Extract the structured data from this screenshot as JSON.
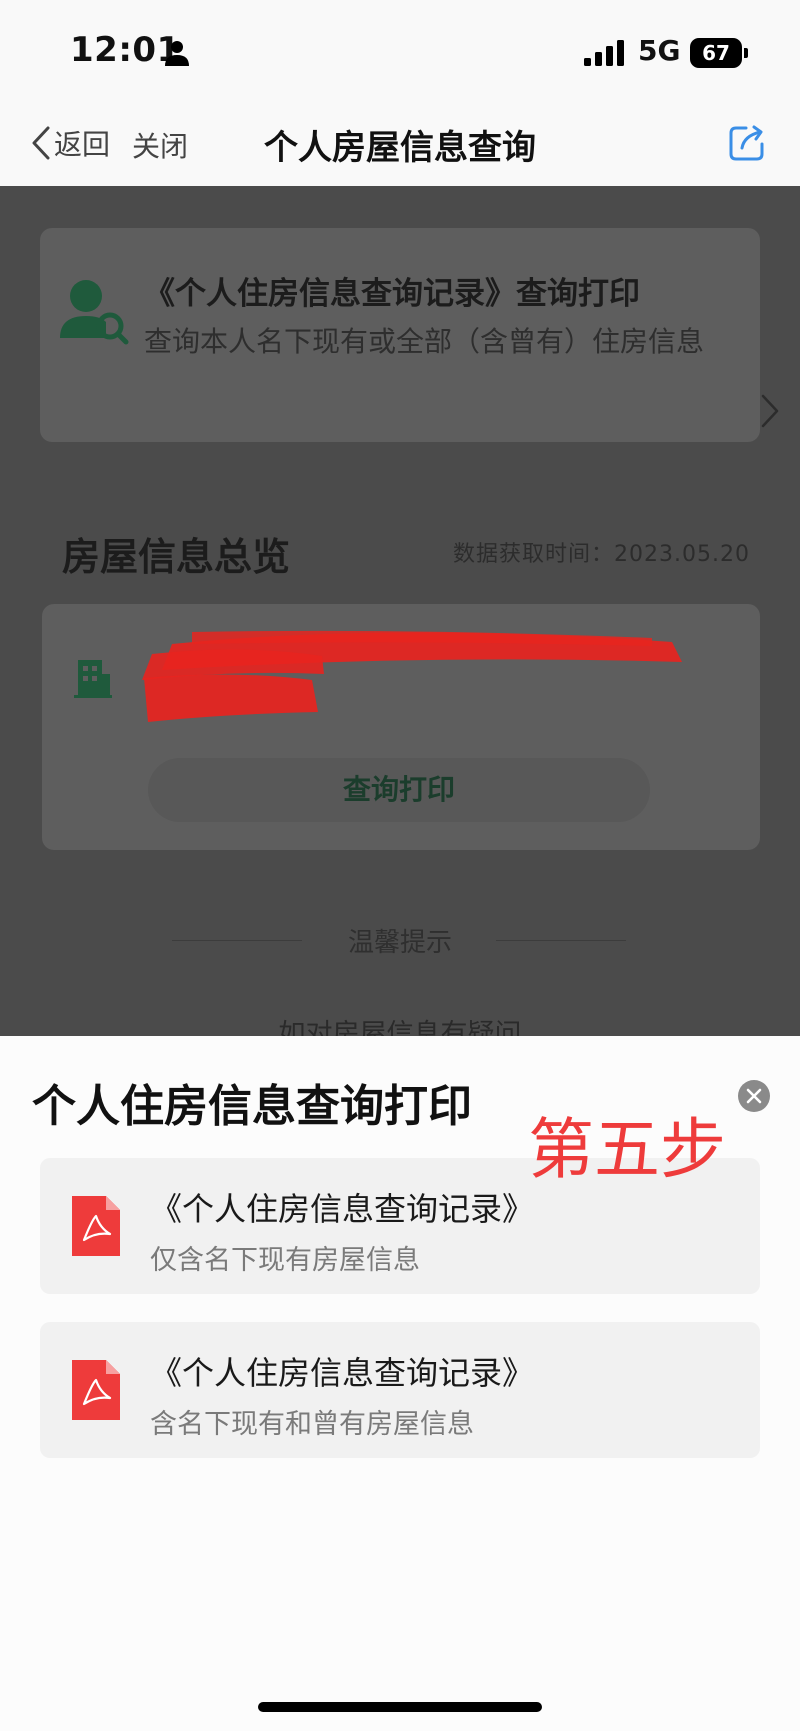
{
  "status_bar": {
    "time": "12:01",
    "network": "5G",
    "battery": "67"
  },
  "nav": {
    "back_label": "返回",
    "close_label": "关闭",
    "title": "个人房屋信息查询"
  },
  "main": {
    "record_card": {
      "title": "《个人住房信息查询记录》查询打印",
      "description": "查询本人名下现有或全部（含曾有）住房信息"
    },
    "overview": {
      "title": "房屋信息总览",
      "fetch_time": "数据获取时间：2023.05.20"
    },
    "house_card": {
      "print_button": "查询打印"
    },
    "tips": {
      "label": "温馨提示",
      "text": "如对房屋信息有疑问"
    }
  },
  "sheet": {
    "title": "个人住房信息查询打印",
    "options": [
      {
        "title": "《个人住房信息查询记录》",
        "description": "仅含名下现有房屋信息"
      },
      {
        "title": "《个人住房信息查询记录》",
        "description": "含名下现有和曾有房屋信息"
      }
    ],
    "annotation": "第五步"
  },
  "colors": {
    "accent_blue": "#3a8ee6",
    "pdf_red": "#ee3b3b",
    "dim_overlay": "#4b4b4b",
    "icon_green": "#1f5a3c"
  },
  "icons": [
    "person-icon",
    "signal-icon",
    "back-chevron-icon",
    "share-icon",
    "user-search-icon",
    "chevron-right-icon",
    "building-icon",
    "close-icon",
    "pdf-icon"
  ]
}
